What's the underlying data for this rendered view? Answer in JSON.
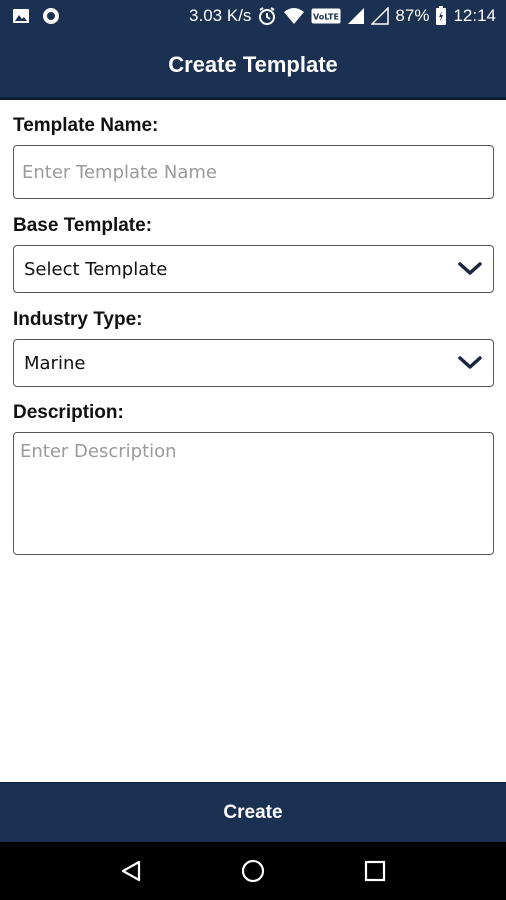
{
  "status_bar": {
    "speed": "3.03 K/s",
    "volte": "VoLTE",
    "battery": "87%",
    "time": "12:14",
    "icons": [
      "image-icon",
      "circle-icon",
      "alarm-icon",
      "wifi-icon",
      "volte-icon",
      "signal-icon",
      "signal-empty-icon",
      "battery-icon"
    ]
  },
  "header": {
    "title": "Create Template"
  },
  "form": {
    "template_name": {
      "label": "Template Name:",
      "placeholder": "Enter Template Name",
      "value": ""
    },
    "base_template": {
      "label": "Base Template:",
      "value": "Select Template"
    },
    "industry_type": {
      "label": "Industry Type:",
      "value": "Marine"
    },
    "description": {
      "label": "Description:",
      "placeholder": "Enter Description",
      "value": ""
    }
  },
  "footer": {
    "create_label": "Create"
  },
  "nav": {
    "icons": [
      "back-icon",
      "home-icon",
      "recents-icon"
    ]
  },
  "colors": {
    "primary": "#1b3151",
    "nav": "#000000",
    "border": "#555555",
    "placeholder": "#9a9a9a"
  }
}
